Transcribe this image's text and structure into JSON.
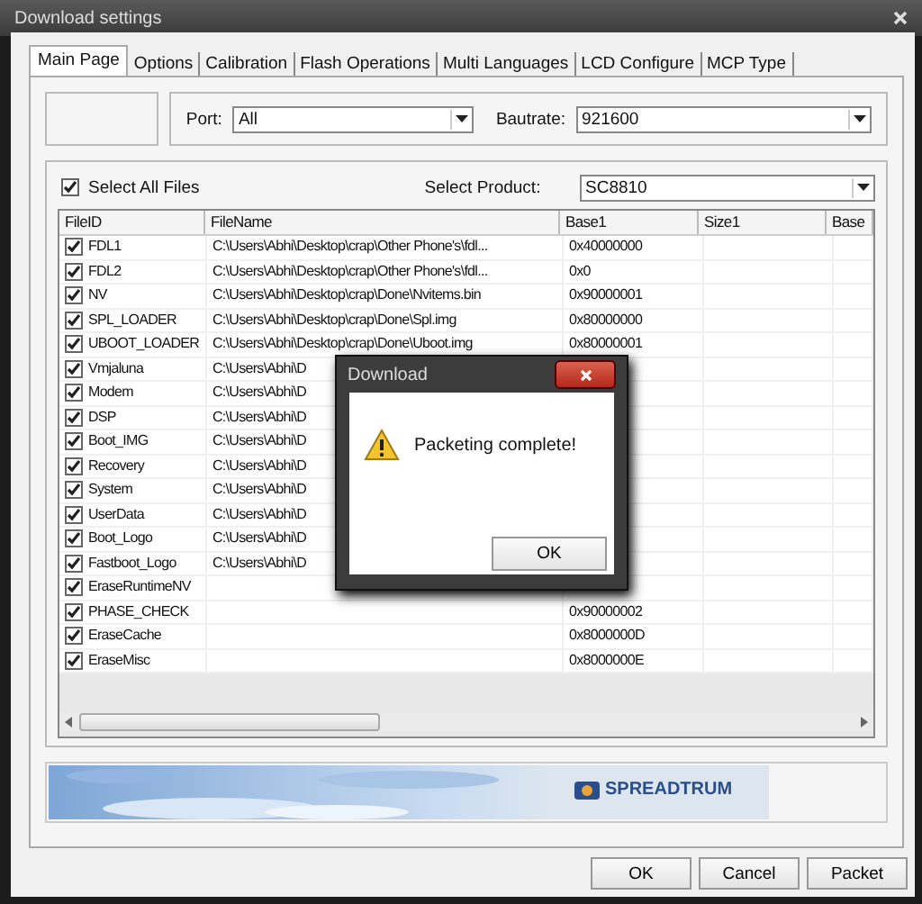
{
  "window": {
    "title": "Download settings"
  },
  "tabs": [
    {
      "label": "Main Page",
      "selected": true
    },
    {
      "label": "Options",
      "selected": false
    },
    {
      "label": "Calibration",
      "selected": false
    },
    {
      "label": "Flash Operations",
      "selected": false
    },
    {
      "label": "Multi Languages",
      "selected": false
    },
    {
      "label": "LCD Configure",
      "selected": false
    },
    {
      "label": "MCP Type",
      "selected": false
    }
  ],
  "port": {
    "label": "Port:",
    "value": "All"
  },
  "baudrate": {
    "label": "Bautrate:",
    "value": "921600"
  },
  "select_all": {
    "label": "Select All Files",
    "checked": true
  },
  "product": {
    "label": "Select Product:",
    "value": "SC8810"
  },
  "table": {
    "columns": [
      "FileID",
      "FileName",
      "Base1",
      "Size1",
      "Base"
    ],
    "rows": [
      {
        "checked": true,
        "file_id": "FDL1",
        "file_name": "C:\\Users\\Abhi\\Desktop\\crap\\Other Phone's\\fdl...",
        "base1": "0x40000000"
      },
      {
        "checked": true,
        "file_id": "FDL2",
        "file_name": "C:\\Users\\Abhi\\Desktop\\crap\\Other Phone's\\fdl...",
        "base1": "0x0"
      },
      {
        "checked": true,
        "file_id": "NV",
        "file_name": "C:\\Users\\Abhi\\Desktop\\crap\\Done\\Nvitems.bin",
        "base1": "0x90000001"
      },
      {
        "checked": true,
        "file_id": "SPL_LOADER",
        "file_name": "C:\\Users\\Abhi\\Desktop\\crap\\Done\\Spl.img",
        "base1": "0x80000000"
      },
      {
        "checked": true,
        "file_id": "UBOOT_LOADER",
        "file_name": "C:\\Users\\Abhi\\Desktop\\crap\\Done\\Uboot.img",
        "base1": "0x80000001"
      },
      {
        "checked": true,
        "file_id": "Vmjaluna",
        "file_name": "C:\\Users\\Abhi\\D"
      },
      {
        "checked": true,
        "file_id": "Modem",
        "file_name": "C:\\Users\\Abhi\\D"
      },
      {
        "checked": true,
        "file_id": "DSP",
        "file_name": "C:\\Users\\Abhi\\D"
      },
      {
        "checked": true,
        "file_id": "Boot_IMG",
        "file_name": "C:\\Users\\Abhi\\D"
      },
      {
        "checked": true,
        "file_id": "Recovery",
        "file_name": "C:\\Users\\Abhi\\D"
      },
      {
        "checked": true,
        "file_id": "System",
        "file_name": "C:\\Users\\Abhi\\D"
      },
      {
        "checked": true,
        "file_id": "UserData",
        "file_name": "C:\\Users\\Abhi\\D"
      },
      {
        "checked": true,
        "file_id": "Boot_Logo",
        "file_name": "C:\\Users\\Abhi\\D"
      },
      {
        "checked": true,
        "file_id": "Fastboot_Logo",
        "file_name": "C:\\Users\\Abhi\\D"
      },
      {
        "checked": true,
        "file_id": "EraseRuntimeNV"
      },
      {
        "checked": true,
        "file_id": "PHASE_CHECK",
        "base1": "0x90000002"
      },
      {
        "checked": true,
        "file_id": "EraseCache",
        "base1": "0x8000000D"
      },
      {
        "checked": true,
        "file_id": "EraseMisc",
        "base1": "0x8000000E"
      }
    ]
  },
  "banner": {
    "logo": "SPREADTRUM"
  },
  "buttons": [
    "OK",
    "Cancel",
    "Packet"
  ],
  "dialog": {
    "title": "Download",
    "message": "Packeting complete!",
    "button": "OK"
  }
}
